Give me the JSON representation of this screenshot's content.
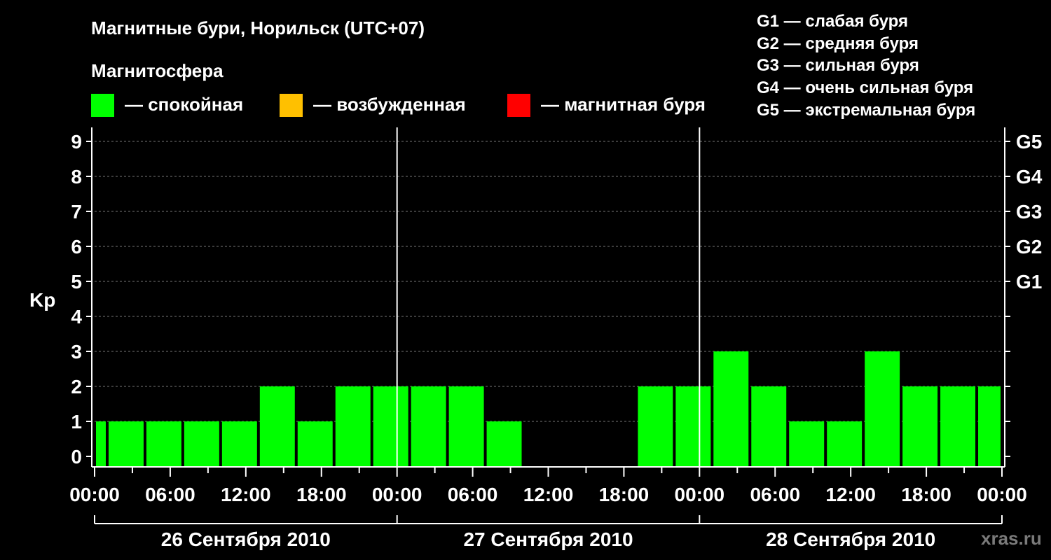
{
  "header": {
    "title": "Магнитные бури, Норильск (UTC+07)",
    "legend_title": "Магнитосфера",
    "legend": [
      {
        "label": "— спокойная",
        "color": "#00ff00"
      },
      {
        "label": "— возбужденная",
        "color": "#ffc000"
      },
      {
        "label": "— магнитная буря",
        "color": "#ff0000"
      }
    ],
    "g_scale": [
      "G1 — слабая буря",
      "G2 — средняя буря",
      "G3 — сильная буря",
      "G4 — очень сильная буря",
      "G5 — экстремальная буря"
    ]
  },
  "watermark": "xras.ru",
  "chart_data": {
    "type": "bar",
    "ylabel": "Kp",
    "ylim": [
      0,
      9
    ],
    "y_ticks": [
      "0",
      "1",
      "2",
      "3",
      "4",
      "5",
      "6",
      "7",
      "8",
      "9"
    ],
    "right_axis_labels": [
      {
        "kp": 5,
        "label": "G1"
      },
      {
        "kp": 6,
        "label": "G2"
      },
      {
        "kp": 7,
        "label": "G3"
      },
      {
        "kp": 8,
        "label": "G4"
      },
      {
        "kp": 9,
        "label": "G5"
      }
    ],
    "x_tick_labels": [
      "00:00",
      "06:00",
      "12:00",
      "18:00",
      "00:00",
      "06:00",
      "12:00",
      "18:00",
      "00:00",
      "06:00",
      "12:00",
      "18:00",
      "00:00"
    ],
    "days": [
      "26 Сентября 2010",
      "27 Сентября 2010",
      "28 Сентября 2010"
    ],
    "grid": true,
    "bar_color": "#00ff00",
    "bars": [
      {
        "start": 0,
        "end": 1,
        "kp": 1
      },
      {
        "start": 1,
        "end": 4,
        "kp": 1
      },
      {
        "start": 4,
        "end": 7,
        "kp": 1
      },
      {
        "start": 7,
        "end": 10,
        "kp": 1
      },
      {
        "start": 10,
        "end": 13,
        "kp": 1
      },
      {
        "start": 13,
        "end": 16,
        "kp": 2
      },
      {
        "start": 16,
        "end": 19,
        "kp": 1
      },
      {
        "start": 19,
        "end": 22,
        "kp": 2
      },
      {
        "start": 22,
        "end": 25,
        "kp": 2
      },
      {
        "start": 25,
        "end": 28,
        "kp": 2
      },
      {
        "start": 28,
        "end": 31,
        "kp": 2
      },
      {
        "start": 31,
        "end": 34,
        "kp": 1
      },
      {
        "start": 43,
        "end": 46,
        "kp": 2
      },
      {
        "start": 46,
        "end": 49,
        "kp": 2
      },
      {
        "start": 49,
        "end": 52,
        "kp": 3
      },
      {
        "start": 52,
        "end": 55,
        "kp": 2
      },
      {
        "start": 55,
        "end": 58,
        "kp": 1
      },
      {
        "start": 58,
        "end": 61,
        "kp": 1
      },
      {
        "start": 61,
        "end": 64,
        "kp": 3
      },
      {
        "start": 64,
        "end": 67,
        "kp": 2
      },
      {
        "start": 67,
        "end": 70,
        "kp": 2
      },
      {
        "start": 70,
        "end": 72,
        "kp": 2
      }
    ]
  }
}
